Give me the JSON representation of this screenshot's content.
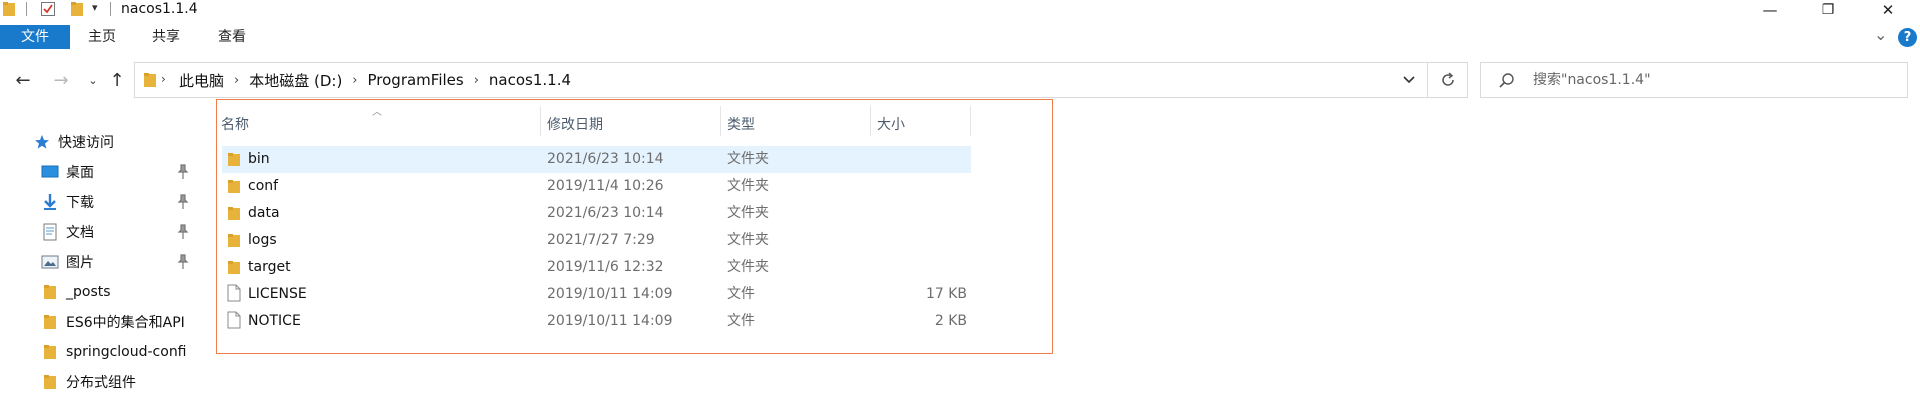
{
  "window": {
    "title": "nacos1.1.4",
    "minimize_glyph": "—",
    "maximize_glyph": "❐",
    "close_glyph": "✕"
  },
  "ribbon": {
    "tabs": [
      "文件",
      "主页",
      "共享",
      "查看"
    ],
    "expand_glyph": "⌄",
    "help_glyph": "?"
  },
  "address": {
    "crumbs": [
      "此电脑",
      "本地磁盘 (D:)",
      "ProgramFiles",
      "nacos1.1.4"
    ],
    "separator": "›"
  },
  "search": {
    "placeholder": "搜索\"nacos1.1.4\""
  },
  "sidebar": {
    "items": [
      {
        "label": "快速访问",
        "icon": "star-icon",
        "pinned": false
      },
      {
        "label": "桌面",
        "icon": "desktop-icon",
        "pinned": true
      },
      {
        "label": "下载",
        "icon": "download-icon",
        "pinned": true
      },
      {
        "label": "文档",
        "icon": "document-icon",
        "pinned": true
      },
      {
        "label": "图片",
        "icon": "picture-icon",
        "pinned": true
      },
      {
        "label": "_posts",
        "icon": "folder-icon",
        "pinned": false
      },
      {
        "label": "ES6中的集合和API",
        "icon": "folder-icon",
        "pinned": false
      },
      {
        "label": "springcloud-confi",
        "icon": "folder-icon",
        "pinned": false
      },
      {
        "label": "分布式组件",
        "icon": "folder-icon",
        "pinned": false
      }
    ]
  },
  "filelist": {
    "columns": [
      "名称",
      "修改日期",
      "类型",
      "大小"
    ],
    "rows": [
      {
        "name": "bin",
        "date": "2021/6/23 10:14",
        "type": "文件夹",
        "size": "",
        "kind": "folder",
        "selected": true
      },
      {
        "name": "conf",
        "date": "2019/11/4 10:26",
        "type": "文件夹",
        "size": "",
        "kind": "folder",
        "selected": false
      },
      {
        "name": "data",
        "date": "2021/6/23 10:14",
        "type": "文件夹",
        "size": "",
        "kind": "folder",
        "selected": false
      },
      {
        "name": "logs",
        "date": "2021/7/27 7:29",
        "type": "文件夹",
        "size": "",
        "kind": "folder",
        "selected": false
      },
      {
        "name": "target",
        "date": "2019/11/6 12:32",
        "type": "文件夹",
        "size": "",
        "kind": "folder",
        "selected": false
      },
      {
        "name": "LICENSE",
        "date": "2019/10/11 14:09",
        "type": "文件",
        "size": "17 KB",
        "kind": "file",
        "selected": false
      },
      {
        "name": "NOTICE",
        "date": "2019/10/11 14:09",
        "type": "文件",
        "size": "2 KB",
        "kind": "file",
        "selected": false
      }
    ]
  },
  "colors": {
    "accent": "#1979ca",
    "folder": "#e8b33a",
    "selection": "#e5f3ff",
    "focus_border": "#ef7d4a"
  }
}
